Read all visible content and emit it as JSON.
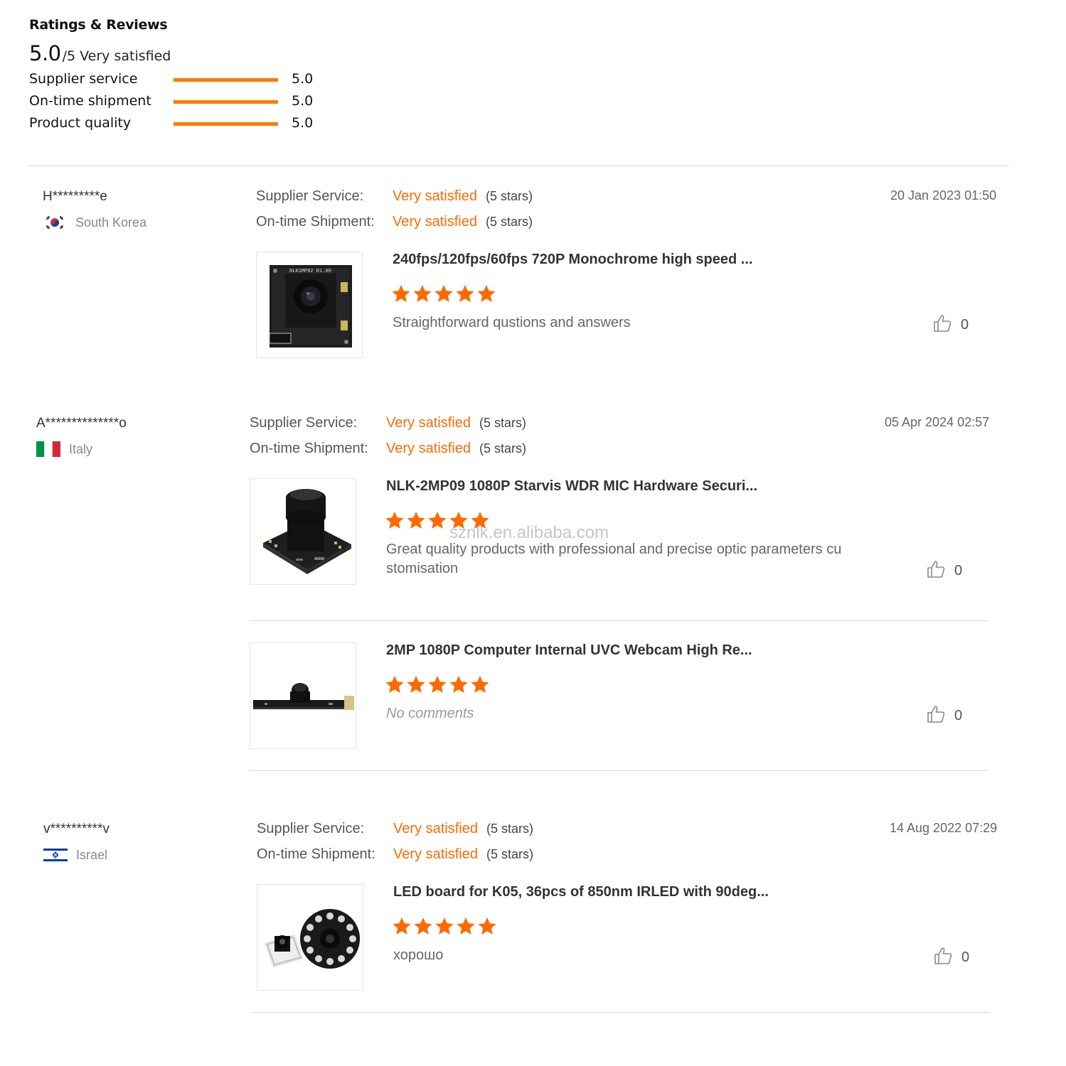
{
  "summary": {
    "title": "Ratings & Reviews",
    "overall_score": "5.0",
    "overall_suffix": "/5 Very satisfied",
    "metrics": [
      {
        "label": "Supplier service",
        "value": "5.0",
        "fill_fraction": 1.0
      },
      {
        "label": "On-time shipment",
        "value": "5.0",
        "fill_fraction": 1.0
      },
      {
        "label": "Product quality",
        "value": "5.0",
        "fill_fraction": 1.0
      }
    ]
  },
  "accent_color": "#ff6a00",
  "bar_color": "#ff7a00",
  "watermark": "sznlk.en.alibaba.com",
  "reviews": [
    {
      "reviewer": "H*********e",
      "country": "South Korea",
      "flag": "south-korea-flag",
      "date": "20 Jan 2023 01:50",
      "supplier_service_label": "Supplier Service:",
      "supplier_service_value": "Very satisfied",
      "supplier_service_stars": "(5 stars)",
      "shipment_label": "On-time Shipment:",
      "shipment_value": "Very satisfied",
      "shipment_stars": "(5 stars)",
      "products": [
        {
          "title": "240fps/120fps/60fps 720P Monochrome high speed ...",
          "rating": 5,
          "comment": "Straightforward qustions and answers",
          "likes": "0",
          "image": "camera-module-board-image"
        }
      ]
    },
    {
      "reviewer": "A**************o",
      "country": "Italy",
      "flag": "italy-flag",
      "date": "05 Apr 2024 02:57",
      "supplier_service_label": "Supplier Service:",
      "supplier_service_value": "Very satisfied",
      "supplier_service_stars": "(5 stars)",
      "shipment_label": "On-time Shipment:",
      "shipment_value": "Very satisfied",
      "shipment_stars": "(5 stars)",
      "products": [
        {
          "title": "NLK-2MP09 1080P Starvis WDR MIC Hardware Securi...",
          "rating": 5,
          "comment": "Great quality products with professional and precise optic parameters customisation",
          "comment_line1": "Great quality products with professional and precise optic parameters cu",
          "comment_line2": "stomisation",
          "likes": "0",
          "image": "camera-lens-module-image"
        },
        {
          "title": "2MP 1080P Computer Internal UVC Webcam High Re...",
          "rating": 5,
          "comment": "No comments",
          "likes": "0",
          "image": "webcam-strip-module-image"
        }
      ]
    },
    {
      "reviewer": "v**********v",
      "country": "Israel",
      "flag": "israel-flag",
      "date": "14 Aug 2022 07:29",
      "supplier_service_label": "Supplier Service:",
      "supplier_service_value": "Very satisfied",
      "supplier_service_stars": "(5 stars)",
      "shipment_label": "On-time Shipment:",
      "shipment_value": "Very satisfied",
      "shipment_stars": "(5 stars)",
      "products": [
        {
          "title": "LED board for K05, 36pcs of 850nm IRLED with 90deg...",
          "rating": 5,
          "comment": "хорошо",
          "likes": "0",
          "image": "ir-led-board-image"
        }
      ]
    }
  ]
}
